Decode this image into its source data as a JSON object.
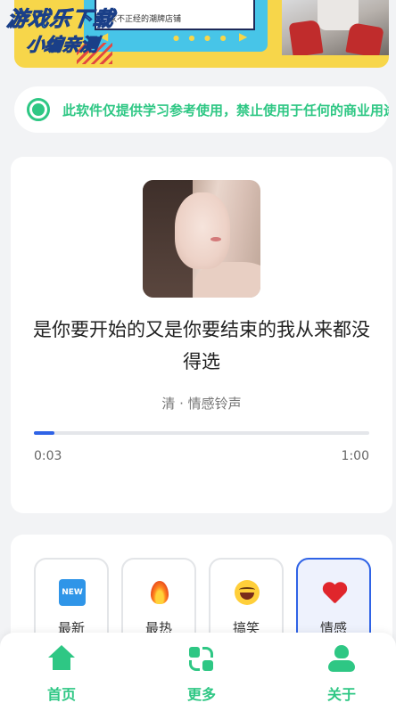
{
  "banner": {
    "screen_text": "家不正经的潮牌店铺",
    "arrow_left": "◀",
    "arrow_right": "▶",
    "dots": "● ● ● ●",
    "watermark_line1": "游戏乐下载",
    "watermark_line2": "小编亲测"
  },
  "notice": {
    "text": "此软件仅提供学习参考使用，禁止使用于任何的商业用途"
  },
  "player": {
    "title": "是你要开始的又是你要结束的我从来都没得选",
    "artist": "清 · 情感铃声",
    "progress": 0.06,
    "time_current": "0:03",
    "time_total": "1:00"
  },
  "categories": [
    {
      "label": "最新",
      "icon": "new-icon",
      "icon_text": "NEW",
      "active": false
    },
    {
      "label": "最热",
      "icon": "fire-icon",
      "active": false
    },
    {
      "label": "搞笑",
      "icon": "laughing-emoji-icon",
      "active": false
    },
    {
      "label": "情感",
      "icon": "heart-icon",
      "active": true
    }
  ],
  "nav": {
    "home": "首页",
    "more": "更多",
    "about": "关于"
  },
  "colors": {
    "accent_green": "#2ec784",
    "accent_blue": "#2f63e6",
    "banner_yellow": "#f7d64a"
  }
}
